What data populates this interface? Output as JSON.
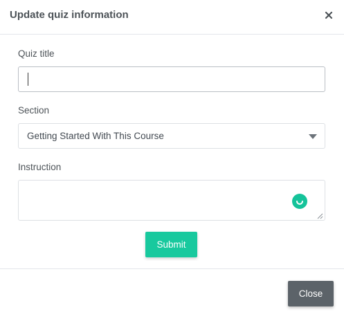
{
  "modal": {
    "title": "Update quiz information",
    "close_icon": "close-icon"
  },
  "form": {
    "quiz_title": {
      "label": "Quiz title",
      "value": "",
      "placeholder": ""
    },
    "section": {
      "label": "Section",
      "selected": "Getting Started With This Course",
      "icon": "chevron-down-icon"
    },
    "instruction": {
      "label": "Instruction",
      "value": "",
      "assistant_icon": "grammarly-icon"
    },
    "submit_label": "Submit"
  },
  "footer": {
    "close_label": "Close"
  },
  "colors": {
    "accent": "#18c99e",
    "close_button": "#5c6369",
    "grammar_icon": "#15c39a"
  }
}
